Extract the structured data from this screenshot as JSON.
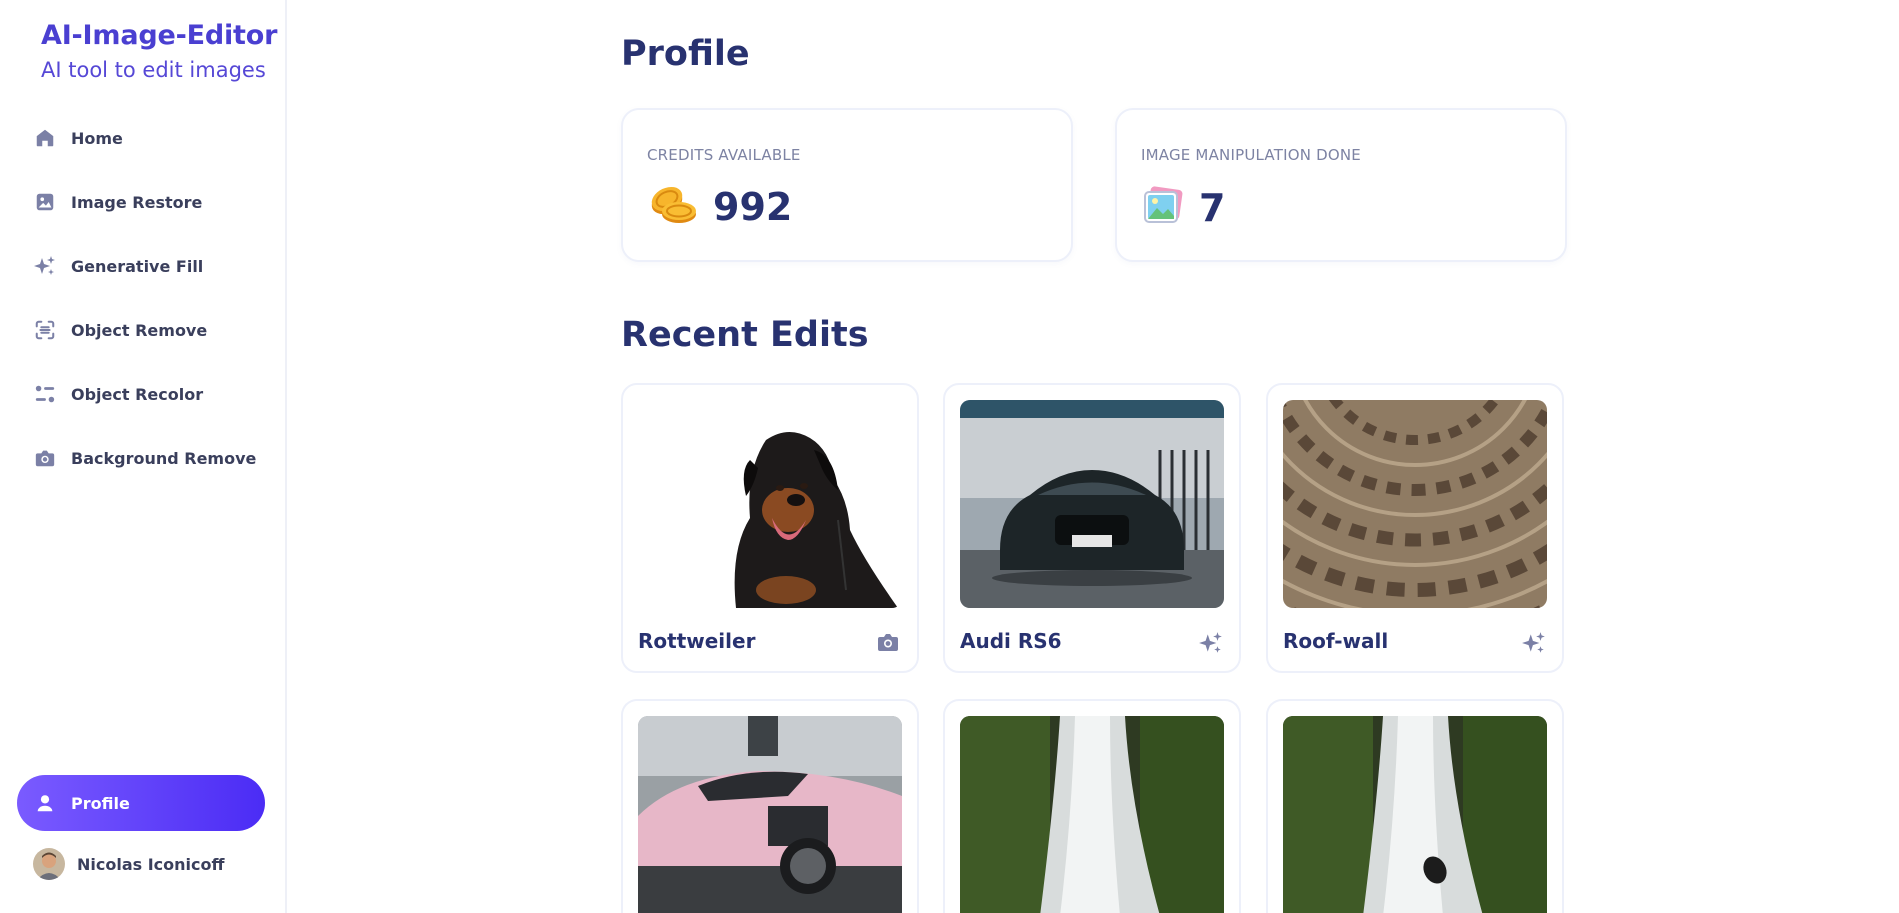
{
  "app": {
    "title": "AI-Image-Editor",
    "subtitle": "AI tool to edit images"
  },
  "sidebar": {
    "items": [
      {
        "label": "Home",
        "icon": "home-icon"
      },
      {
        "label": "Image Restore",
        "icon": "image-icon"
      },
      {
        "label": "Generative Fill",
        "icon": "sparkles-icon"
      },
      {
        "label": "Object Remove",
        "icon": "scan-icon"
      },
      {
        "label": "Object Recolor",
        "icon": "filter-icon"
      },
      {
        "label": "Background Remove",
        "icon": "camera-icon"
      }
    ],
    "active": {
      "label": "Profile",
      "icon": "user-icon"
    },
    "user": {
      "name": "Nicolas Iconicoff"
    }
  },
  "main": {
    "title": "Profile",
    "stats": [
      {
        "label": "CREDITS AVAILABLE",
        "value": "992",
        "icon": "coins-icon"
      },
      {
        "label": "IMAGE MANIPULATION DONE",
        "value": "7",
        "icon": "picture-icon"
      }
    ],
    "recent_title": "Recent Edits",
    "edits": [
      {
        "title": "Rottweiler",
        "type_icon": "camera-icon"
      },
      {
        "title": "Audi RS6",
        "type_icon": "sparkles-icon"
      },
      {
        "title": "Roof-wall",
        "type_icon": "sparkles-icon"
      },
      {
        "title": "",
        "type_icon": ""
      },
      {
        "title": "",
        "type_icon": ""
      },
      {
        "title": "",
        "type_icon": ""
      }
    ]
  },
  "colors": {
    "brand": "#4a3fd1",
    "accent_gradient_start": "#7a5bff",
    "accent_gradient_end": "#4b2cf5",
    "heading": "#283270"
  }
}
